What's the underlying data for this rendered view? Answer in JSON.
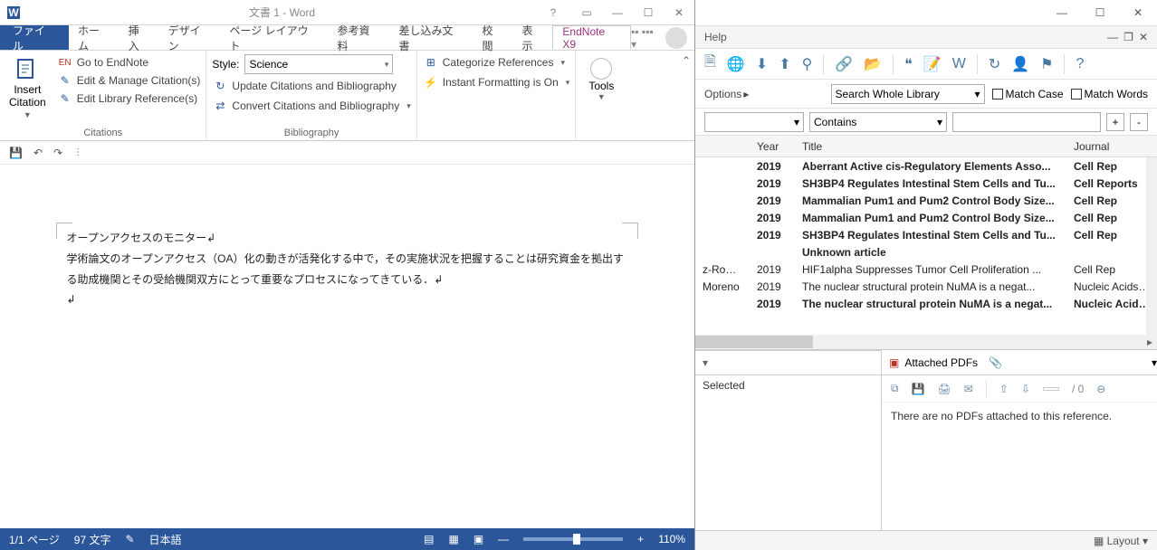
{
  "word": {
    "title": "文書 1 - Word",
    "menubar": [
      "ファイル",
      "ホーム",
      "挿入",
      "デザイン",
      "ページ レイアウト",
      "参考資料",
      "差し込み文書",
      "校閲",
      "表示",
      "EndNote X9"
    ],
    "ribbon": {
      "insert_citation": "Insert\nCitation",
      "go_to_endnote": "Go to EndNote",
      "edit_manage": "Edit & Manage Citation(s)",
      "edit_library": "Edit Library Reference(s)",
      "citations_label": "Citations",
      "style_label": "Style:",
      "style_value": "Science",
      "update_cit": "Update Citations and Bibliography",
      "convert_cit": "Convert Citations and Bibliography",
      "biblio_label": "Bibliography",
      "categorize": "Categorize References",
      "instant_fmt": "Instant Formatting is On",
      "tools": "Tools"
    },
    "document": {
      "p1": "オープンアクセスのモニター↲",
      "p2": "学術論文のオープンアクセス（OA）化の動きが活発化する中で，その実施状況を把握することは研究資金を拠出する助成機関とその受給機関双方にとって重要なプロセスになってきている．↲",
      "p3": "↲"
    },
    "status": {
      "page": "1/1 ページ",
      "words": "97 文字",
      "lang": "日本語",
      "zoom": "110%"
    }
  },
  "endnote": {
    "menu": "Help",
    "search": {
      "options": "Options",
      "scope": "Search Whole Library",
      "match_case": "Match Case",
      "match_words": "Match Words",
      "contains": "Contains"
    },
    "columns": {
      "year": "Year",
      "title": "Title",
      "journal": "Journal"
    },
    "rows": [
      {
        "author": "",
        "year": "2019",
        "title": "Aberrant Active cis-Regulatory Elements Asso...",
        "journal": "Cell Rep",
        "bold": true
      },
      {
        "author": "",
        "year": "2019",
        "title": "SH3BP4 Regulates Intestinal Stem Cells and Tu...",
        "journal": "Cell Reports",
        "bold": true
      },
      {
        "author": "",
        "year": "2019",
        "title": "Mammalian Pum1 and Pum2 Control Body Size...",
        "journal": "Cell Rep",
        "bold": true
      },
      {
        "author": "",
        "year": "2019",
        "title": "Mammalian Pum1 and Pum2 Control Body Size...",
        "journal": "Cell Rep",
        "bold": true
      },
      {
        "author": "",
        "year": "2019",
        "title": "SH3BP4 Regulates Intestinal Stem Cells and Tu...",
        "journal": "Cell Rep",
        "bold": true
      },
      {
        "author": "",
        "year": "",
        "title": "Unknown article",
        "journal": "",
        "bold": true
      },
      {
        "author": "z-Rodri...",
        "year": "2019",
        "title": "HIF1alpha Suppresses Tumor Cell Proliferation ...",
        "journal": "Cell Rep",
        "bold": false
      },
      {
        "author": "Moreno",
        "year": "2019",
        "title": "The nuclear structural protein NuMA is a negat...",
        "journal": "Nucleic Acids R...",
        "bold": false
      },
      {
        "author": "",
        "year": "2019",
        "title": "The nuclear structural protein NuMA is a negat...",
        "journal": "Nucleic Acids R...",
        "bold": true
      }
    ],
    "preview_selected": "Selected",
    "pdf": {
      "tab": "Attached PDFs",
      "page": "/ 0",
      "empty": "There are no PDFs attached to this reference."
    },
    "layout": "Layout"
  }
}
